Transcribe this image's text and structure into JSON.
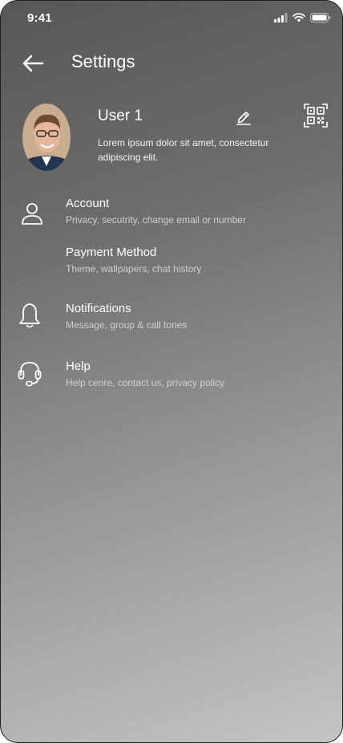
{
  "status_bar": {
    "time": "9:41",
    "icons": [
      "cellular-signal-icon",
      "wifi-icon",
      "battery-icon"
    ]
  },
  "header": {
    "title": "Settings",
    "back_icon": "arrow-left-icon"
  },
  "profile": {
    "name": "User 1",
    "bio": "Lorem ipsum dolor sit amet, consectetur adipiscing elit.",
    "edit_icon": "pencil-icon",
    "qr_icon": "qr-code-icon"
  },
  "menu": {
    "items": [
      {
        "icon": "user-icon",
        "title": "Account",
        "subtitle": "Privacy, secutrity, change email or number"
      },
      {
        "icon": "",
        "title": "Payment Method",
        "subtitle": "Theme, wallpapers, chat history"
      },
      {
        "icon": "bell-icon",
        "title": "Notifications",
        "subtitle": "Message, group & call tones"
      },
      {
        "icon": "headset-icon",
        "title": "Help",
        "subtitle": "Help cenre, contact us, privacy policy"
      }
    ]
  },
  "colors": {
    "text": "#ffffff",
    "subtitle": "#cfcfcf",
    "gradient_top": "#575757",
    "gradient_bottom": "#c4c4c4"
  }
}
